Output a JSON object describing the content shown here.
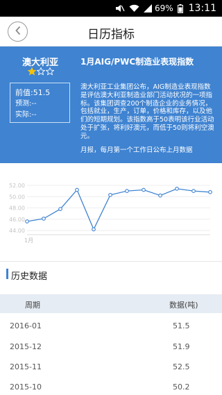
{
  "status_bar": {
    "battery": "69%",
    "time": "13:11",
    "icons": [
      "mute-icon",
      "wifi-icon",
      "signal-icon",
      "battery-icon"
    ]
  },
  "header": {
    "title": "日历指标",
    "back_icon": "chevron-left-icon"
  },
  "indicator": {
    "country": "澳大利亚",
    "stars": 1,
    "stars_max": 3,
    "title": "1月AIG/PWC制造业表现指数",
    "previous": "前值:51.5",
    "forecast": "预测:--",
    "actual": "实际:--",
    "description": "澳大利亚工业集团公布，AIG制造业表现指数是评估澳大利亚制造业部门活动状况的一项指标。该集团调查200个制造企业的业务情况，包括就业，生产，订单，价格和库存，以及他们的短期规划。该指数高于50表明该行业活动处于扩张，将利好澳元，而低于50则将利空澳元。",
    "frequency": "月报，每月第一个工作日公布上月数据",
    "colors": {
      "panel_bg": "#3f83d1",
      "line": "#3f83d1"
    }
  },
  "chart_data": {
    "type": "line",
    "x_tick_labels": [
      "1月"
    ],
    "y_tick_labels": [
      "52.00",
      "50.00",
      "48.00",
      "46.00",
      "44.00"
    ],
    "ylim": [
      44,
      52
    ],
    "grid": true,
    "series": [
      {
        "values": [
          45.6,
          46.1,
          47.8,
          51.2,
          44.2,
          50.3,
          51.0,
          51.2,
          50.2,
          51.4,
          51.0,
          50.8
        ]
      }
    ]
  },
  "history": {
    "title": "历史数据",
    "columns": [
      "周期",
      "数据(吨)"
    ],
    "rows": [
      {
        "period": "2016-01",
        "value": "51.5"
      },
      {
        "period": "2015-12",
        "value": "51.9"
      },
      {
        "period": "2015-11",
        "value": "52.5"
      },
      {
        "period": "2015-10",
        "value": "50.2"
      }
    ]
  }
}
